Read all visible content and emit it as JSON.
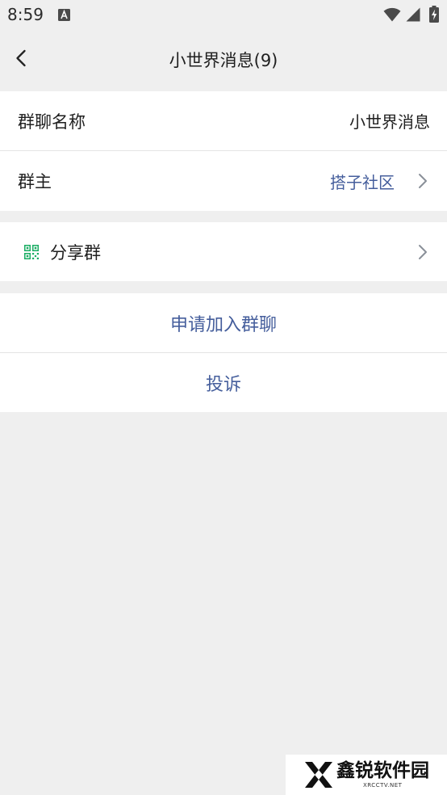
{
  "status_bar": {
    "time": "8:59",
    "icons": {
      "notification": "a-notification-icon",
      "wifi": "wifi-icon",
      "signal": "signal-icon",
      "battery": "battery-charging-icon"
    }
  },
  "header": {
    "back_icon": "chevron-left-icon",
    "title": "小世界消息(9)"
  },
  "group_info": {
    "name_row": {
      "label": "群聊名称",
      "value": "小世界消息"
    },
    "owner_row": {
      "label": "群主",
      "value": "搭子社区",
      "icon": "chevron-right-icon"
    }
  },
  "share": {
    "icon": "qr-code-icon",
    "label": "分享群",
    "chevron_icon": "chevron-right-icon"
  },
  "actions": {
    "join_label": "申请加入群聊",
    "report_label": "投诉"
  },
  "watermark": {
    "logo_icon": "x-logo-icon",
    "brand": "鑫锐软件园",
    "site": "XRCCTV.NET"
  },
  "colors": {
    "page_bg": "#efefef",
    "surface": "#ffffff",
    "text": "#1f1f1f",
    "link": "#455e9c",
    "chevron": "#8a9099",
    "qr_green": "#1aad63",
    "divider": "#e4e4e4",
    "status_icon": "#4a4a4a"
  }
}
